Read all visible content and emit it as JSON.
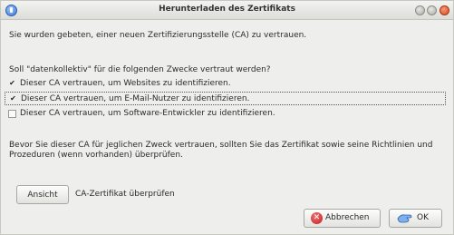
{
  "window": {
    "title": "Herunterladen des Zertifikats"
  },
  "dialog": {
    "intro": "Sie wurden gebeten, einer neuen Zertifizierungsstelle (CA) zu vertrauen.",
    "question": "Soll \"datenkollektiv\" für die folgenden Zwecke vertraut werden?",
    "options": [
      {
        "label": "Dieser CA vertrauen, um Websites zu identifizieren.",
        "checked": true,
        "mark": "✔"
      },
      {
        "label": "Dieser CA vertrauen, um E-Mail-Nutzer zu identifizieren.",
        "checked": true,
        "mark": "✔"
      },
      {
        "label": "Dieser CA vertrauen, um Software-Entwickler zu identifizieren.",
        "checked": false,
        "mark": ""
      }
    ],
    "warning": "Bevor Sie dieser CA für jeglichen Zweck vertrauen, sollten Sie das Zertifikat sowie seine Richtlinien und Prozeduren (wenn vorhanden) überprüfen.",
    "view_button": "Ansicht",
    "view_hint": "CA-Zertifikat überprüfen"
  },
  "buttons": {
    "cancel": "Abbrechen",
    "ok": "OK"
  },
  "icons": {
    "app": "firefox-icon",
    "cancel": "cancel-icon",
    "ok": "ok-hand-icon"
  },
  "colors": {
    "close_button": "#d64a1e",
    "cancel_icon": "#c21d1d",
    "ok_icon": "#4a86d4"
  }
}
